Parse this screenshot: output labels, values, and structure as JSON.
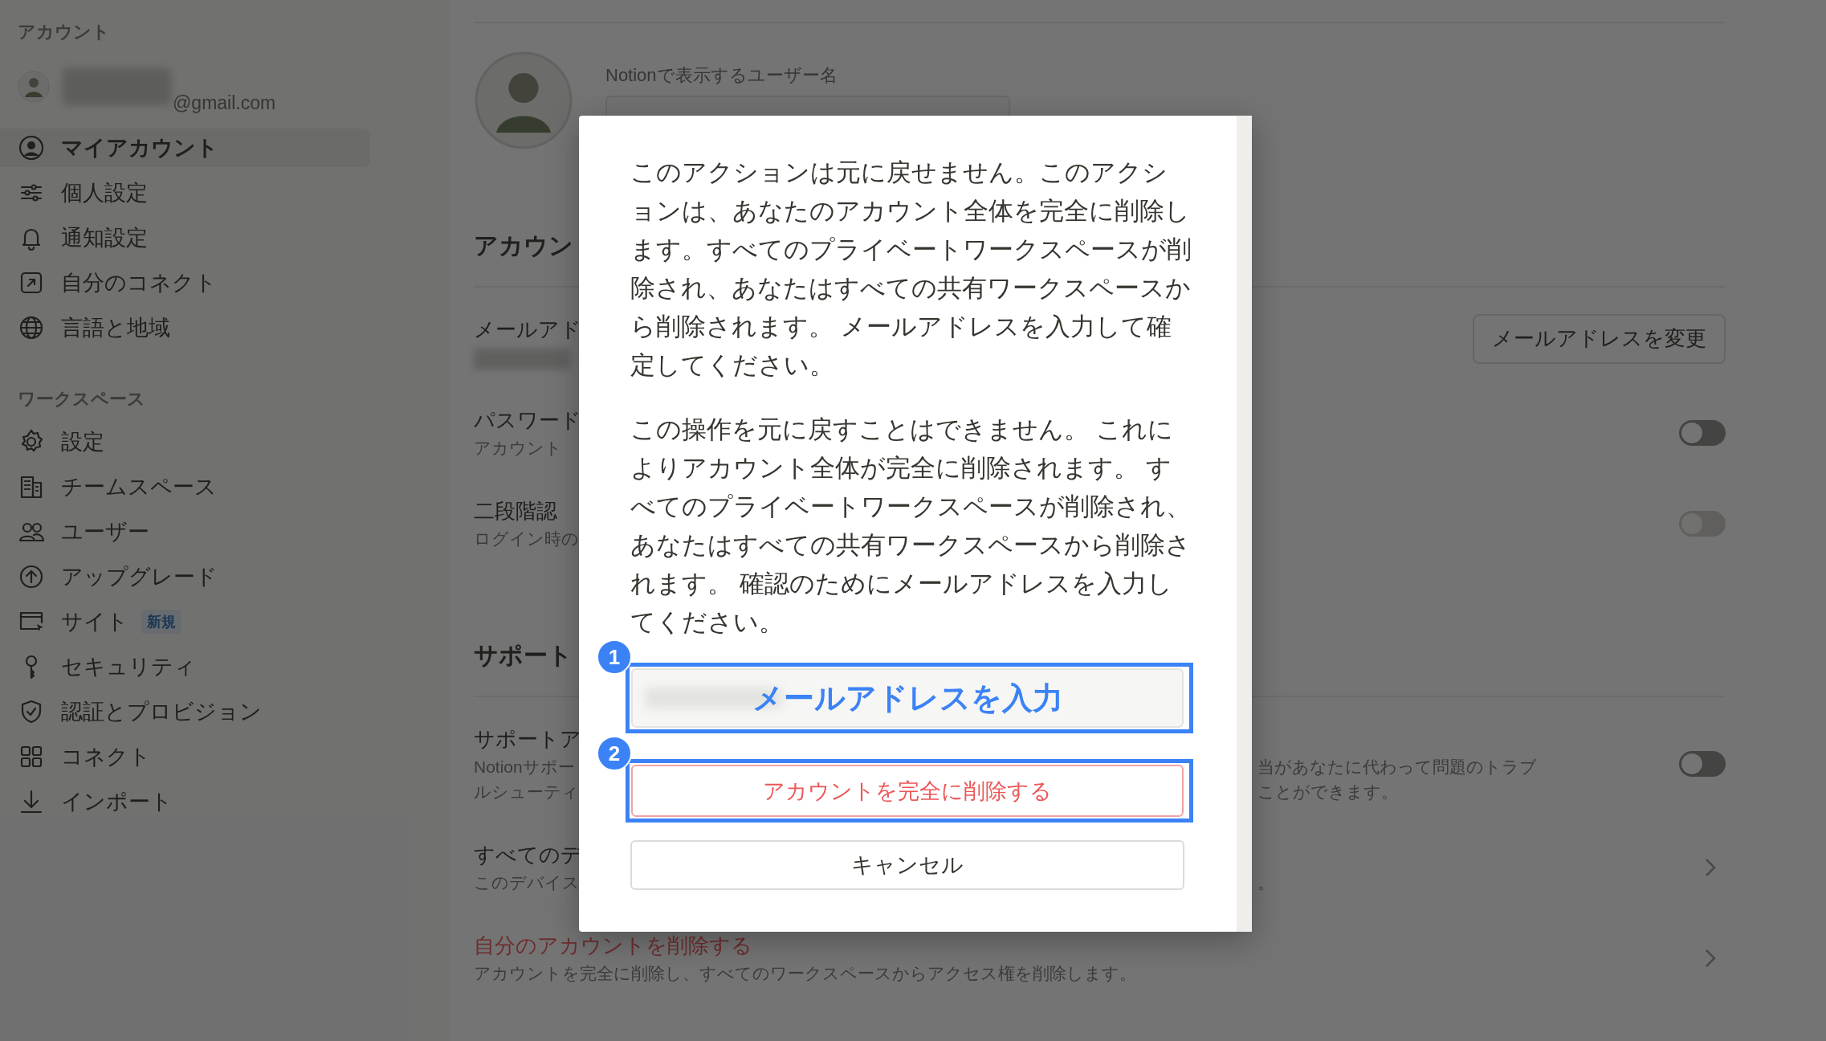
{
  "sidebar": {
    "sections": [
      {
        "title": "アカウント",
        "account": {
          "email_suffix": "@gmail.com"
        },
        "items": [
          {
            "label": "マイアカウント",
            "selected": true
          },
          {
            "label": "個人設定",
            "selected": false
          },
          {
            "label": "通知設定",
            "selected": false
          },
          {
            "label": "自分のコネクト",
            "selected": false
          },
          {
            "label": "言語と地域",
            "selected": false
          }
        ]
      },
      {
        "title": "ワークスペース",
        "items": [
          {
            "label": "設定",
            "selected": false
          },
          {
            "label": "チームスペース",
            "selected": false
          },
          {
            "label": "ユーザー",
            "selected": false
          },
          {
            "label": "アップグレード",
            "selected": false
          },
          {
            "label": "サイト",
            "badge": "新規",
            "selected": false
          },
          {
            "label": "セキュリティ",
            "selected": false
          },
          {
            "label": "認証とプロビジョン",
            "selected": false
          },
          {
            "label": "コネクト",
            "selected": false
          },
          {
            "label": "インポート",
            "selected": false
          }
        ]
      }
    ]
  },
  "main": {
    "profile": {
      "label": "Notionで表示するユーザー名"
    },
    "sections": [
      {
        "heading": "アカウン",
        "rows": [
          {
            "kind": "button",
            "title": "メールアド",
            "button": "メールアドレスを変更"
          },
          {
            "kind": "toggle",
            "title": "パスワード",
            "lines": [
              {
                "left": "アカウント"
              }
            ],
            "on": false,
            "disabled": false
          },
          {
            "kind": "toggle",
            "title": "二段階認",
            "lines": [
              {
                "left": "ログイン時の"
              }
            ],
            "on": false,
            "disabled": true
          }
        ]
      },
      {
        "heading": "サポート",
        "rows": [
          {
            "kind": "toggle",
            "title": "サポートア",
            "lines": [
              {
                "left": "Notionサポー",
                "right": "当があなたに代わって問題のトラブ"
              },
              {
                "left": "ルシューティ",
                "right": "ことができます。"
              }
            ],
            "on": false,
            "disabled": false
          },
          {
            "kind": "link",
            "title": "すべてのデ",
            "danger": false,
            "lines": [
              {
                "left": "このデバイス",
                "right": "。"
              }
            ]
          },
          {
            "kind": "link",
            "title": "自分のアカウントを削除する",
            "danger": true,
            "lines": [
              {
                "left": "アカウントを完全に削除し、すべてのワークスペースからアクセス権を削除します。"
              }
            ]
          }
        ]
      }
    ]
  },
  "dialog": {
    "paragraphs": [
      "このアクションは元に戻せません。このアクションは、あなたのアカウント全体を完全に削除します。すべてのプライベートワークスペースが削除され、あなたはすべての共有ワークスペースから削除されます。 メールアドレスを入力して確定してください。",
      "この操作を元に戻すことはできません。 これによりアカウント全体が完全に削除されます。 すべてのプライベートワークスペースが削除され、あなたはすべての共有ワークスペースから削除されます。 確認のためにメールアドレスを入力してください。"
    ],
    "email_field": {
      "annotation": "メールアドレスを入力",
      "step": "1"
    },
    "delete_button": {
      "label": "アカウントを完全に削除する",
      "step": "2"
    },
    "cancel_button": {
      "label": "キャンセル"
    }
  }
}
